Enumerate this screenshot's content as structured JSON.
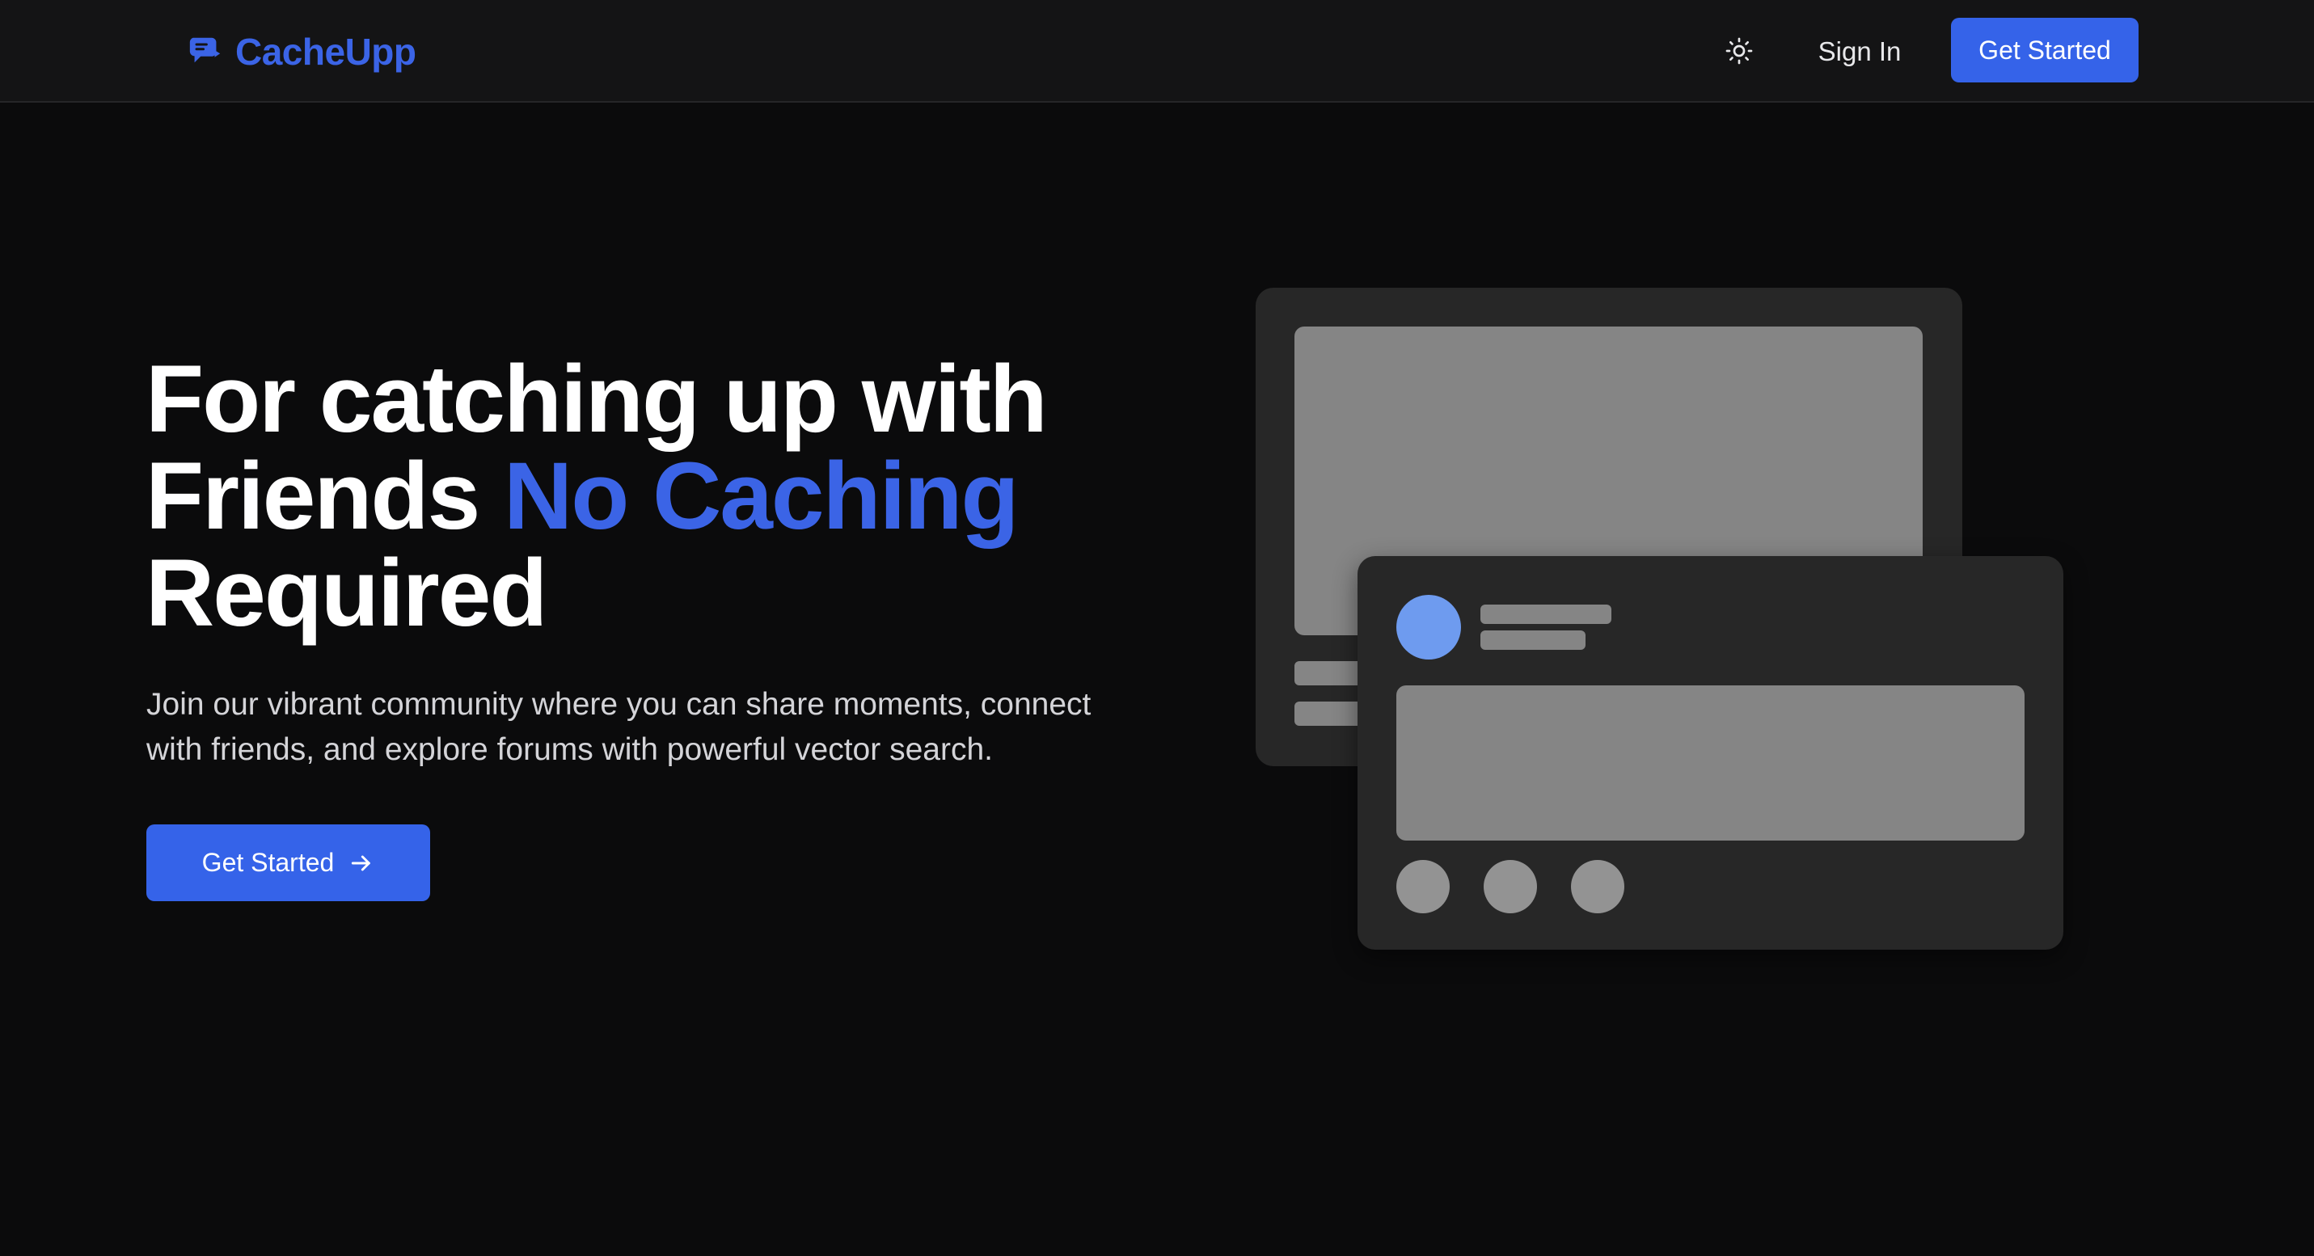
{
  "nav": {
    "brand": "CacheUpp",
    "brand_icon": "chat-icon",
    "theme_icon": "sun-icon",
    "sign_in": "Sign In",
    "get_started": "Get Started"
  },
  "hero": {
    "title_line1": "For catching up with",
    "title_line2_plain": "Friends ",
    "title_line2_accent": "No Caching",
    "title_line3": "Required",
    "subtitle": "Join our vibrant community where you can share moments, connect with friends, and explore forums with powerful vector search.",
    "cta": "Get Started",
    "cta_icon": "arrow-right-icon"
  },
  "colors": {
    "accent": "#3b64e6",
    "button": "#3563e9",
    "background": "#0b0b0c",
    "navbar": "#141415"
  }
}
